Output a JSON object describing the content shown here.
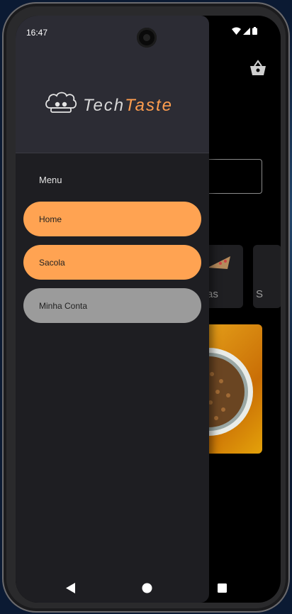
{
  "status_bar": {
    "time": "16:47"
  },
  "brand": {
    "logo_tech": "Tech",
    "logo_taste": "Taste"
  },
  "drawer": {
    "menu_title": "Menu",
    "items": [
      {
        "label": "Home",
        "state": "active"
      },
      {
        "label": "Sacola",
        "state": "active"
      },
      {
        "label": "Minha Conta",
        "state": "inactive"
      }
    ]
  },
  "background_app": {
    "categories": [
      {
        "label_partial": "ssas"
      },
      {
        "label_partial": "S"
      }
    ]
  },
  "colors": {
    "accent": "#ffa352",
    "inactive_item": "#9b9b9b",
    "drawer_bg": "#1e1e22",
    "header_bg": "#2c2c34"
  },
  "icons": [
    "basket-icon",
    "chef-hat-logo-icon",
    "wifi-icon",
    "signal-icon",
    "battery-icon",
    "back-icon",
    "home-icon",
    "recents-icon"
  ]
}
